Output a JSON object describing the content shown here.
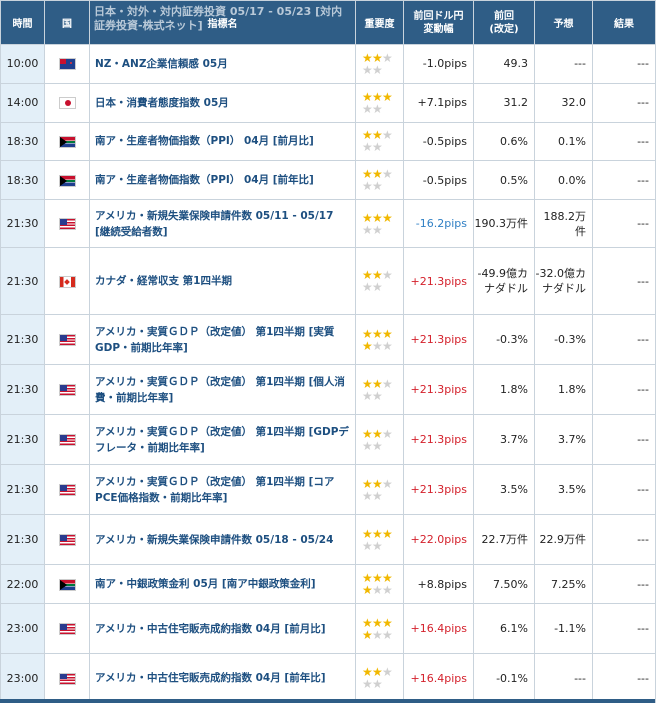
{
  "header": {
    "time": "時間",
    "country": "国",
    "indicator": "指標名",
    "overlay": "日本・対外・対内証券投資 05/17 - 05/23 [対内証券投資-株式ネット]",
    "importance": "重要度",
    "pips_l1": "前回ドル円",
    "pips_l2": "変動幅",
    "prev_l1": "前回",
    "prev_l2": "(改定)",
    "forecast": "予想",
    "result": "結果"
  },
  "colors": {
    "header_bg": "#2f5d86",
    "time_bg": "#e3eff8",
    "up": "#d4202b",
    "down": "#2f7fc4",
    "name": "#1d4f80",
    "star_on": "#f1b800",
    "star_off": "#d0d0d0"
  },
  "rows": [
    {
      "time": "10:00",
      "country": "nz-flag-icon",
      "name": "NZ・ANZ企業信頼感 05月",
      "stars": 2,
      "pips": "-1.0pips",
      "dir": "neu",
      "prev": "49.3",
      "forecast": "---",
      "result": "---"
    },
    {
      "time": "14:00",
      "country": "jp-flag-icon",
      "name": "日本・消費者態度指数 05月",
      "stars": 3,
      "pips": "+7.1pips",
      "dir": "neu",
      "prev": "31.2",
      "forecast": "32.0",
      "result": "---"
    },
    {
      "time": "18:30",
      "country": "za-flag-icon",
      "name": "南ア・生産者物価指数（PPI） 04月 [前月比]",
      "stars": 2,
      "pips": "-0.5pips",
      "dir": "neu",
      "prev": "0.6%",
      "forecast": "0.1%",
      "result": "---"
    },
    {
      "time": "18:30",
      "country": "za-flag-icon",
      "name": "南ア・生産者物価指数（PPI） 04月 [前年比]",
      "stars": 2,
      "pips": "-0.5pips",
      "dir": "neu",
      "prev": "0.5%",
      "forecast": "0.0%",
      "result": "---"
    },
    {
      "time": "21:30",
      "country": "us-flag-icon",
      "name": "アメリカ・新規失業保険申請件数 05/11 - 05/17 [継続受給者数]",
      "stars": 3,
      "pips": "-16.2pips",
      "dir": "down",
      "prev": "190.3万件",
      "forecast": "188.2万件",
      "result": "---"
    },
    {
      "time": "21:30",
      "country": "ca-flag-icon",
      "name": "カナダ・経常収支 第1四半期",
      "stars": 2,
      "pips": "+21.3pips",
      "dir": "up",
      "prev": "-49.9億カナダドル",
      "forecast": "-32.0億カナダドル",
      "result": "---"
    },
    {
      "time": "21:30",
      "country": "us-flag-icon",
      "name": "アメリカ・実質ＧＤＰ（改定値） 第1四半期 [実質GDP・前期比年率]",
      "stars": 4,
      "pips": "+21.3pips",
      "dir": "up",
      "prev": "-0.3%",
      "forecast": "-0.3%",
      "result": "---"
    },
    {
      "time": "21:30",
      "country": "us-flag-icon",
      "name": "アメリカ・実質ＧＤＰ（改定値） 第1四半期 [個人消費・前期比年率]",
      "stars": 2,
      "pips": "+21.3pips",
      "dir": "up",
      "prev": "1.8%",
      "forecast": "1.8%",
      "result": "---"
    },
    {
      "time": "21:30",
      "country": "us-flag-icon",
      "name": "アメリカ・実質ＧＤＰ（改定値） 第1四半期 [GDPデフレータ・前期比年率]",
      "stars": 2,
      "pips": "+21.3pips",
      "dir": "up",
      "prev": "3.7%",
      "forecast": "3.7%",
      "result": "---"
    },
    {
      "time": "21:30",
      "country": "us-flag-icon",
      "name": "アメリカ・実質ＧＤＰ（改定値） 第1四半期 [コアPCE価格指数・前期比年率]",
      "stars": 2,
      "pips": "+21.3pips",
      "dir": "up",
      "prev": "3.5%",
      "forecast": "3.5%",
      "result": "---"
    },
    {
      "time": "21:30",
      "country": "us-flag-icon",
      "name": "アメリカ・新規失業保険申請件数 05/18 - 05/24",
      "stars": 3,
      "pips": "+22.0pips",
      "dir": "up",
      "prev": "22.7万件",
      "forecast": "22.9万件",
      "result": "---"
    },
    {
      "time": "22:00",
      "country": "za-flag-icon",
      "name": "南ア・中銀政策金利 05月 [南ア中銀政策金利]",
      "stars": 4,
      "pips": "+8.8pips",
      "dir": "neu",
      "prev": "7.50%",
      "forecast": "7.25%",
      "result": "---"
    },
    {
      "time": "23:00",
      "country": "us-flag-icon",
      "name": "アメリカ・中古住宅販売成約指数 04月 [前月比]",
      "stars": 4,
      "pips": "+16.4pips",
      "dir": "up",
      "prev": "6.1%",
      "forecast": "-1.1%",
      "result": "---"
    },
    {
      "time": "23:00",
      "country": "us-flag-icon",
      "name": "アメリカ・中古住宅販売成約指数 04月 [前年比]",
      "stars": 2,
      "pips": "+16.4pips",
      "dir": "up",
      "prev": "-0.1%",
      "forecast": "---",
      "result": "---"
    }
  ]
}
